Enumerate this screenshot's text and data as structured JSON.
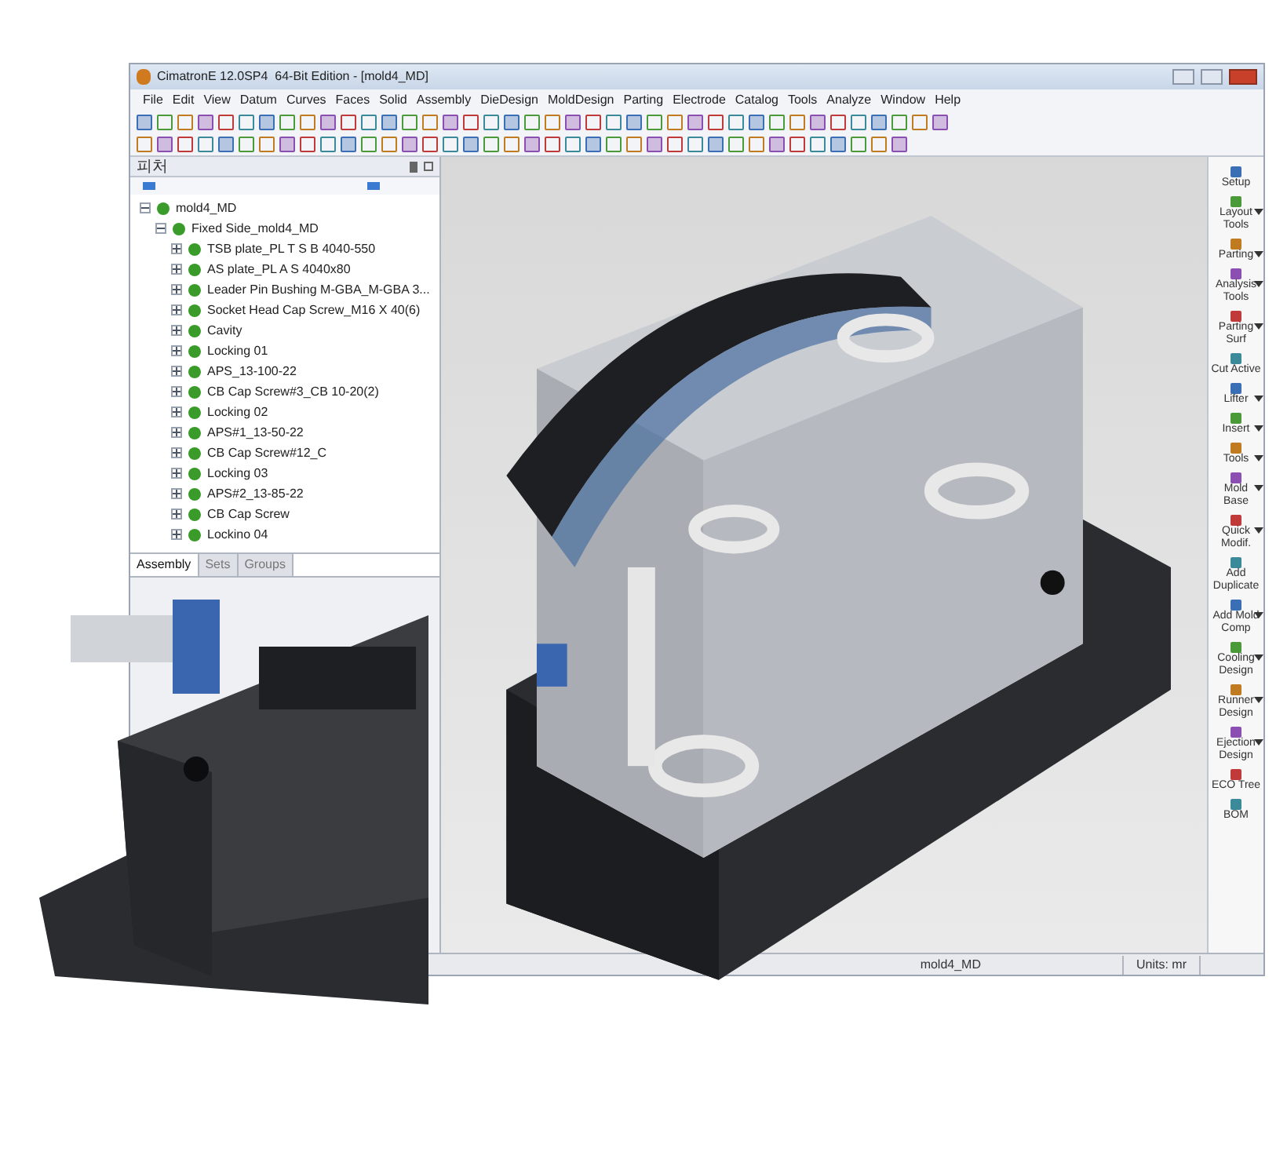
{
  "window": {
    "title": "CimatronE 12.0SP4  64-Bit Edition - [mold4_MD]"
  },
  "menu": [
    "File",
    "Edit",
    "View",
    "Datum",
    "Curves",
    "Faces",
    "Solid",
    "Assembly",
    "DieDesign",
    "MoldDesign",
    "Parting",
    "Electrode",
    "Catalog",
    "Tools",
    "Analyze",
    "Window",
    "Help"
  ],
  "panel": {
    "title": "피처",
    "tree": [
      {
        "label": "mold4_MD",
        "expanded": true,
        "children": [
          {
            "label": "Fixed Side_mold4_MD",
            "expanded": true,
            "children": [
              {
                "label": "TSB plate_PL T S B 4040-550",
                "expanded": false
              },
              {
                "label": "AS plate_PL A S 4040x80",
                "expanded": false
              },
              {
                "label": "Leader Pin Bushing M-GBA_M-GBA 3...",
                "expanded": false
              },
              {
                "label": "Socket Head Cap Screw_M16 X 40(6)",
                "expanded": false
              },
              {
                "label": "Cavity",
                "expanded": false
              },
              {
                "label": "Locking 01",
                "expanded": false
              },
              {
                "label": "APS_13-100-22",
                "expanded": false
              },
              {
                "label": "CB Cap Screw#3_CB 10-20(2)",
                "expanded": false
              },
              {
                "label": "Locking 02",
                "expanded": false
              },
              {
                "label": "APS#1_13-50-22",
                "expanded": false
              },
              {
                "label": "CB Cap Screw#12_C",
                "expanded": false
              },
              {
                "label": "Locking 03",
                "expanded": false
              },
              {
                "label": "APS#2_13-85-22",
                "expanded": false
              },
              {
                "label": "CB Cap Screw",
                "expanded": false
              },
              {
                "label": "Lockino 04",
                "expanded": false
              }
            ]
          }
        ]
      }
    ],
    "tabs": [
      {
        "label": "Assembly",
        "selected": true
      },
      {
        "label": "Sets",
        "selected": false
      },
      {
        "label": "Groups",
        "selected": false
      }
    ]
  },
  "side_toolbar": [
    {
      "lines": [
        "Setup"
      ],
      "has_menu": false
    },
    {
      "lines": [
        "Layout",
        "Tools"
      ],
      "has_menu": true
    },
    {
      "lines": [
        "Parting"
      ],
      "has_menu": true
    },
    {
      "lines": [
        "Analysis",
        "Tools"
      ],
      "has_menu": true
    },
    {
      "lines": [
        "Parting",
        "Surf"
      ],
      "has_menu": true
    },
    {
      "lines": [
        "Cut Active"
      ],
      "has_menu": false
    },
    {
      "lines": [
        "Lifter"
      ],
      "has_menu": true
    },
    {
      "lines": [
        "Insert"
      ],
      "has_menu": true
    },
    {
      "lines": [
        "Tools"
      ],
      "has_menu": true
    },
    {
      "lines": [
        "Mold",
        "Base"
      ],
      "has_menu": true
    },
    {
      "lines": [
        "Quick",
        "Modif."
      ],
      "has_menu": true
    },
    {
      "lines": [
        "Add",
        "Duplicate"
      ],
      "has_menu": false
    },
    {
      "lines": [
        "Add Mold",
        "Comp"
      ],
      "has_menu": true
    },
    {
      "lines": [
        "Cooling",
        "Design"
      ],
      "has_menu": true
    },
    {
      "lines": [
        "Runner",
        "Design"
      ],
      "has_menu": true
    },
    {
      "lines": [
        "Ejection",
        "Design"
      ],
      "has_menu": true
    },
    {
      "lines": [
        "ECO Tree"
      ],
      "has_menu": false
    },
    {
      "lines": [
        "BOM"
      ],
      "has_menu": false
    }
  ],
  "status_bar": {
    "file": "mold4_MD",
    "units": "Units: mr"
  }
}
